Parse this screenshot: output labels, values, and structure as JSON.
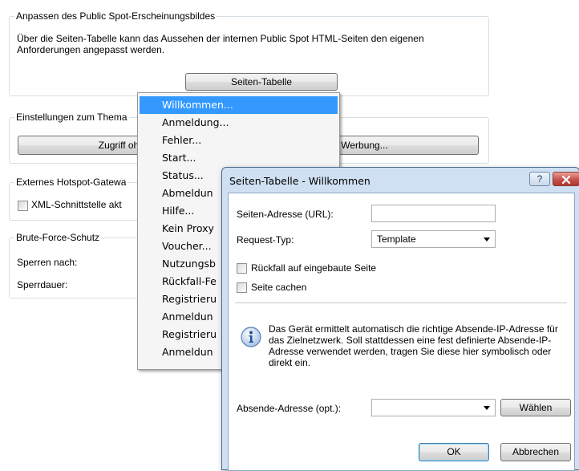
{
  "groups": {
    "appearance": {
      "legend": "Anpassen des Public Spot-Erscheinungsbildes",
      "description": "Über die Seiten-Tabelle kann das Aussehen der internen Public Spot HTML-Seiten den eigenen Anforderungen angepasst werden.",
      "button": "Seiten-Tabelle"
    },
    "theme": {
      "legend": "Einstellungen zum Thema",
      "button_left": "Zugriff ohne Ar",
      "button_right": "Werbung..."
    },
    "gateway": {
      "legend": "Externes Hotspot-Gatewa",
      "checkbox": "XML-Schnittstelle akt"
    },
    "bruteforce": {
      "legend": "Brute-Force-Schutz",
      "lock_after": "Sperren nach:",
      "lock_duration": "Sperrdauer:"
    }
  },
  "menu": {
    "items": [
      "Willkommen...",
      "Anmeldung...",
      "Fehler...",
      "Start...",
      "Status...",
      "Abmeldun",
      "Hilfe...",
      "Kein Proxy",
      "Voucher...",
      "Nutzungsb",
      "Rückfall-Fe",
      "Registrieru",
      "Anmeldun",
      "Registrieru",
      "Anmeldun"
    ],
    "selected_index": 0
  },
  "dialog": {
    "title": "Seiten-Tabelle - Willkommen",
    "help_button": "?",
    "close_icon": "close-icon",
    "url_label": "Seiten-Adresse (URL):",
    "url_value": "",
    "request_type_label": "Request-Typ:",
    "request_type_value": "Template",
    "fallback_label": "Rückfall auf eingebaute Seite",
    "cache_label": "Seite cachen",
    "info_icon": "info-icon",
    "info_text": "Das Gerät ermittelt automatisch die richtige Absende-IP-Adresse für das Zielnetzwerk. Soll stattdessen eine fest definierte Absende-IP-Adresse verwendet werden, tragen Sie diese hier symbolisch oder direkt ein.",
    "sender_label": "Absende-Adresse (opt.):",
    "sender_value": "",
    "choose_button": "Wählen",
    "ok_button": "OK",
    "cancel_button": "Abbrechen"
  },
  "colors": {
    "menu_highlight": "#3399ff",
    "dialog_frame": "#cfe0f2",
    "close_button": "#c75050"
  }
}
